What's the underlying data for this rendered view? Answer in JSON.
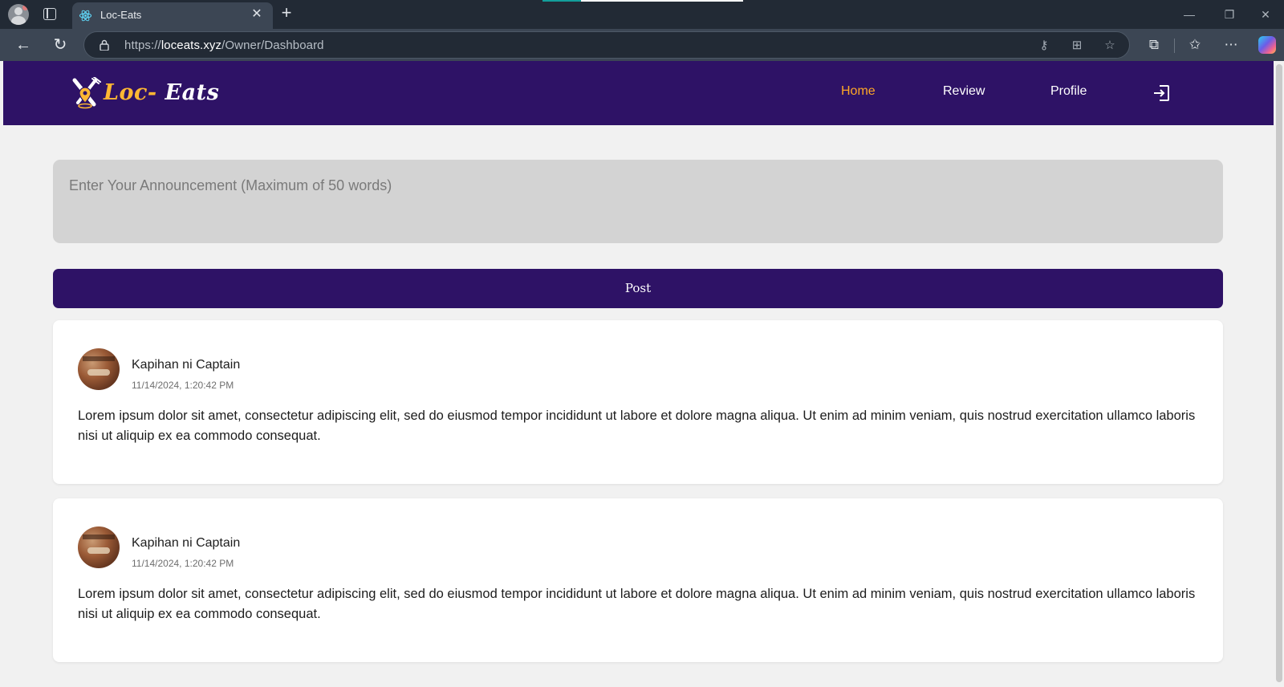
{
  "browser": {
    "tab_title": "Loc-Eats",
    "url_prefix": "https://",
    "url_host": "loceats.xyz",
    "url_path": "/Owner/Dashboard",
    "icons": [
      "profile-icon",
      "tabs-icon",
      "react-favicon",
      "close-icon",
      "plus-icon",
      "back-icon",
      "reload-icon",
      "lock-icon",
      "key-icon",
      "app-icon",
      "star-icon",
      "extensions-icon",
      "favorites-icon",
      "more-icon",
      "copilot-icon",
      "minimize-icon",
      "maximize-icon",
      "window-close-icon"
    ]
  },
  "app": {
    "logo_part1": "Loc-",
    "logo_part2": " Eats",
    "nav": {
      "home": "Home",
      "review": "Review",
      "profile": "Profile"
    },
    "colors": {
      "brand": "#2e1266",
      "accent": "#ffa726",
      "input_bg": "#d3d3d3"
    },
    "announcement_placeholder": "Enter Your Announcement (Maximum of 50 words)",
    "post_label": "Post",
    "posts": [
      {
        "author": "Kapihan ni Captain",
        "timestamp": "11/14/2024, 1:20:42 PM",
        "body": "Lorem ipsum dolor sit amet, consectetur adipiscing elit, sed do eiusmod tempor incididunt ut labore et dolore magna aliqua. Ut enim ad minim veniam, quis nostrud exercitation ullamco laboris nisi ut aliquip ex ea commodo consequat."
      },
      {
        "author": "Kapihan ni Captain",
        "timestamp": "11/14/2024, 1:20:42 PM",
        "body": "Lorem ipsum dolor sit amet, consectetur adipiscing elit, sed do eiusmod tempor incididunt ut labore et dolore magna aliqua. Ut enim ad minim veniam, quis nostrud exercitation ullamco laboris nisi ut aliquip ex ea commodo consequat."
      }
    ]
  }
}
